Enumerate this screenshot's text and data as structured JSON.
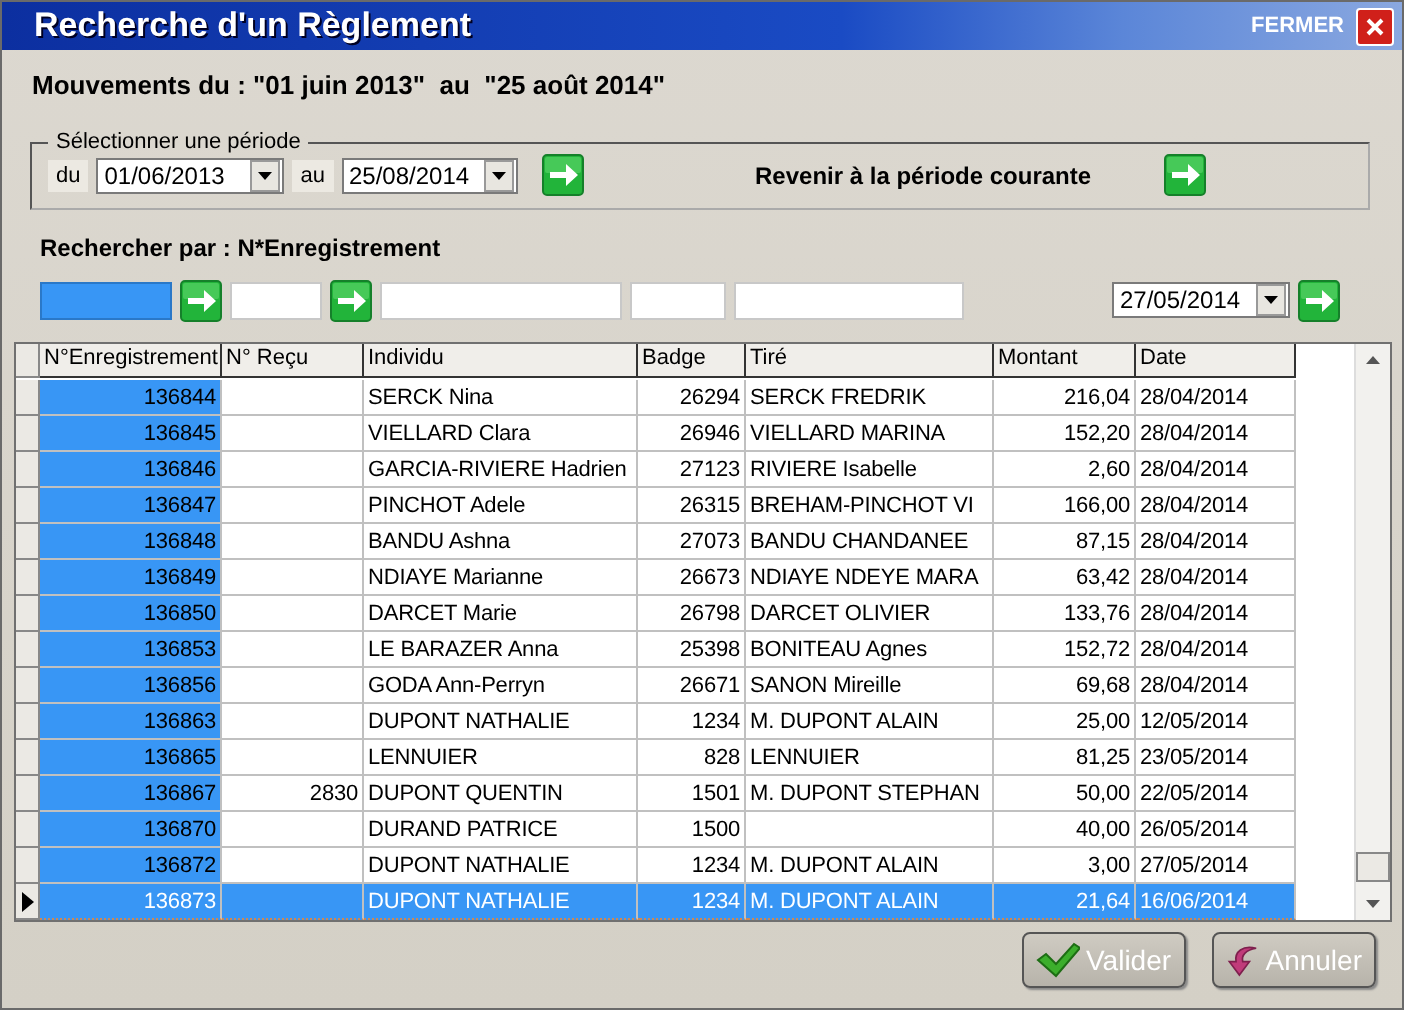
{
  "window": {
    "title": "Recherche d'un Règlement",
    "close_label": "FERMER"
  },
  "movements": "Mouvements du : \"01 juin 2013\"  au  \"25 août 2014\"",
  "period": {
    "legend": "Sélectionner une période",
    "from_label": "du",
    "from": "01/06/2013",
    "to_label": "au",
    "to": "25/08/2014",
    "reset_label": "Revenir à la période courante"
  },
  "search": {
    "label": "Rechercher par : N*Enregistrement",
    "date": "27/05/2014",
    "fields": [
      {
        "selected": true,
        "has_go": true
      },
      {
        "selected": false,
        "has_go": true
      },
      {
        "selected": false,
        "has_go": false
      },
      {
        "selected": false,
        "has_go": false
      },
      {
        "selected": false,
        "has_go": false
      }
    ]
  },
  "grid": {
    "columns": [
      {
        "label": "N°Enregistrement",
        "selected": true
      },
      {
        "label": "N° Reçu",
        "selected": false
      },
      {
        "label": "Individu",
        "selected": false
      },
      {
        "label": "Badge",
        "selected": false
      },
      {
        "label": "Tiré",
        "selected": false
      },
      {
        "label": "Montant",
        "selected": false
      },
      {
        "label": "Date",
        "selected": false
      }
    ],
    "rows": [
      {
        "selected": false,
        "cells": [
          "136844",
          null,
          "SERCK Nina",
          "26294",
          "SERCK FREDRIK",
          "216,04",
          "28/04/2014"
        ]
      },
      {
        "selected": false,
        "cells": [
          "136845",
          null,
          "VIELLARD Clara",
          "26946",
          "VIELLARD MARINA",
          "152,20",
          "28/04/2014"
        ]
      },
      {
        "selected": false,
        "cells": [
          "136846",
          null,
          "GARCIA-RIVIERE Hadrien",
          "27123",
          "RIVIERE Isabelle",
          "2,60",
          "28/04/2014"
        ]
      },
      {
        "selected": false,
        "cells": [
          "136847",
          null,
          "PINCHOT Adele",
          "26315",
          "BREHAM-PINCHOT VI",
          "166,00",
          "28/04/2014"
        ]
      },
      {
        "selected": false,
        "cells": [
          "136848",
          null,
          "BANDU Ashna",
          "27073",
          "BANDU CHANDANEE",
          "87,15",
          "28/04/2014"
        ]
      },
      {
        "selected": false,
        "cells": [
          "136849",
          null,
          "NDIAYE Marianne",
          "26673",
          "NDIAYE NDEYE MARA",
          "63,42",
          "28/04/2014"
        ]
      },
      {
        "selected": false,
        "cells": [
          "136850",
          null,
          "DARCET Marie",
          "26798",
          "DARCET OLIVIER",
          "133,76",
          "28/04/2014"
        ]
      },
      {
        "selected": false,
        "cells": [
          "136853",
          null,
          "LE BARAZER Anna",
          "25398",
          "BONITEAU Agnes",
          "152,72",
          "28/04/2014"
        ]
      },
      {
        "selected": false,
        "cells": [
          "136856",
          null,
          "GODA Ann-Perryn",
          "26671",
          "SANON Mireille",
          "69,68",
          "28/04/2014"
        ]
      },
      {
        "selected": false,
        "cells": [
          "136863",
          null,
          "DUPONT NATHALIE",
          "1234",
          "M. DUPONT ALAIN",
          "25,00",
          "12/05/2014"
        ]
      },
      {
        "selected": false,
        "cells": [
          "136865",
          null,
          "LENNUIER",
          "828",
          "LENNUIER",
          "81,25",
          "23/05/2014"
        ]
      },
      {
        "selected": false,
        "cells": [
          "136867",
          "2830",
          "DUPONT QUENTIN",
          "1501",
          "M. DUPONT STEPHAN",
          "50,00",
          "22/05/2014"
        ]
      },
      {
        "selected": false,
        "cells": [
          "136870",
          null,
          "DURAND PATRICE",
          "1500",
          null,
          "40,00",
          "26/05/2014"
        ]
      },
      {
        "selected": false,
        "cells": [
          "136872",
          null,
          "DUPONT NATHALIE",
          "1234",
          "M. DUPONT ALAIN",
          "3,00",
          "27/05/2014"
        ]
      },
      {
        "selected": true,
        "cells": [
          "136873",
          null,
          "DUPONT NATHALIE",
          "1234",
          "M. DUPONT ALAIN",
          "21,64",
          "16/06/2014"
        ]
      }
    ]
  },
  "buttons": [
    {
      "label": "Valider",
      "kind": "ok"
    },
    {
      "label": "Annuler",
      "kind": "cancel"
    }
  ]
}
